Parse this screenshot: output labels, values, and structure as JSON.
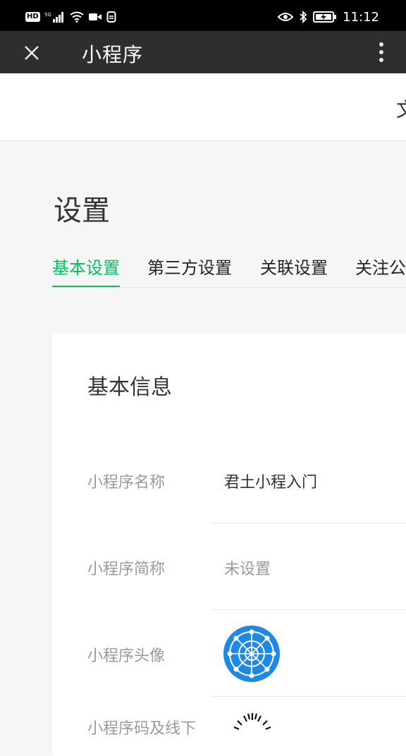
{
  "status_bar": {
    "left_badge": "HD",
    "network_label": "5G",
    "time": "11:12"
  },
  "title_bar": {
    "title": "小程序",
    "close_icon": "close-icon",
    "more_icon": "more-vertical-icon"
  },
  "top_box": {
    "partial_text": "文"
  },
  "page": {
    "title": "设置",
    "tabs": [
      {
        "label": "基本设置",
        "active": true
      },
      {
        "label": "第三方设置",
        "active": false
      },
      {
        "label": "关联设置",
        "active": false
      },
      {
        "label": "关注公",
        "active": false
      }
    ]
  },
  "card": {
    "title": "基本信息",
    "rows": [
      {
        "label": "小程序名称",
        "value": "君土小程入门"
      },
      {
        "label": "小程序简称",
        "value": "未设置"
      },
      {
        "label": "小程序头像",
        "value": ""
      },
      {
        "label": "小程序码及线下",
        "value": ""
      }
    ]
  },
  "colors": {
    "accent": "#07c160",
    "title_bar_bg": "#2e2e2e",
    "page_bg": "#f6f6f6",
    "avatar_blue": "#1e88e5"
  }
}
